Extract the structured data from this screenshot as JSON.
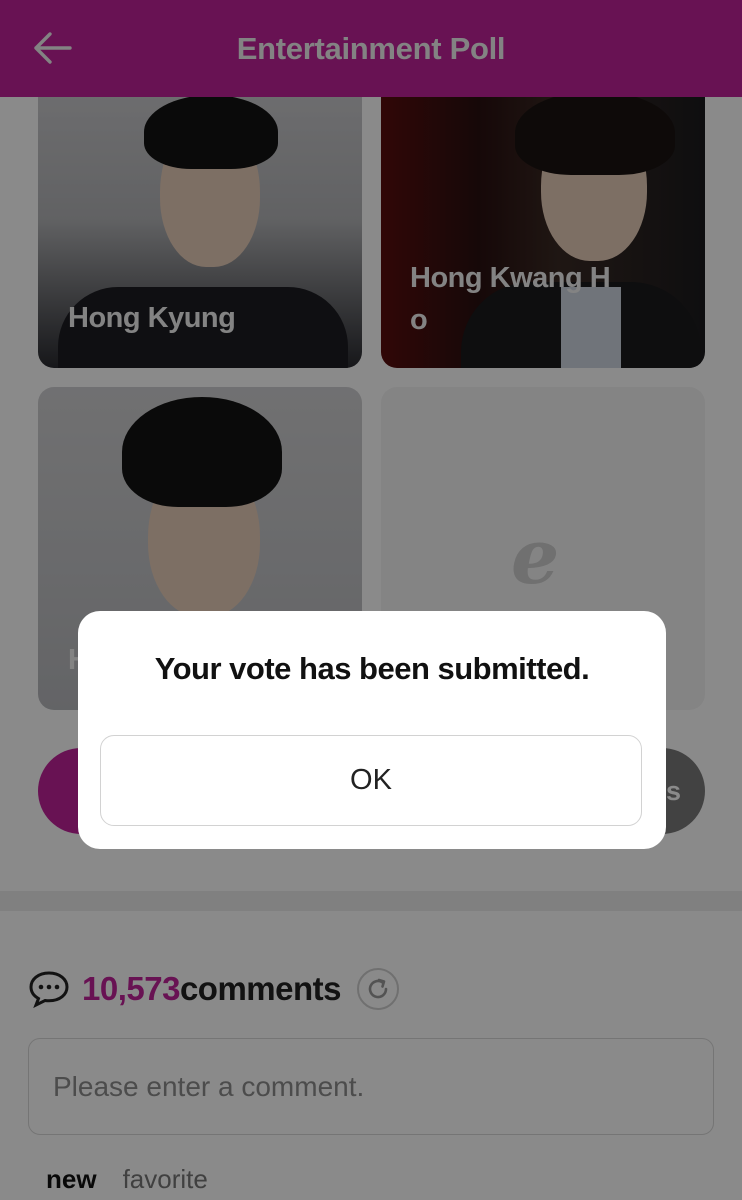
{
  "header": {
    "title": "Entertainment Poll",
    "back_icon": "arrow-left-icon"
  },
  "brand_color": "#c0229a",
  "candidates": [
    {
      "name": "Hong Kyung"
    },
    {
      "name": "Hong Kwang H\no"
    },
    {
      "name": "H"
    }
  ],
  "placeholder_logo": "e",
  "actions": {
    "vote_label": "",
    "results_label": "s"
  },
  "comments": {
    "count": "10,573",
    "label": "comments",
    "placeholder": "Please enter a comment.",
    "sort": {
      "new": "new",
      "favorite": "favorite"
    }
  },
  "dialog": {
    "message": "Your vote has been submitted.",
    "ok_label": "OK"
  }
}
